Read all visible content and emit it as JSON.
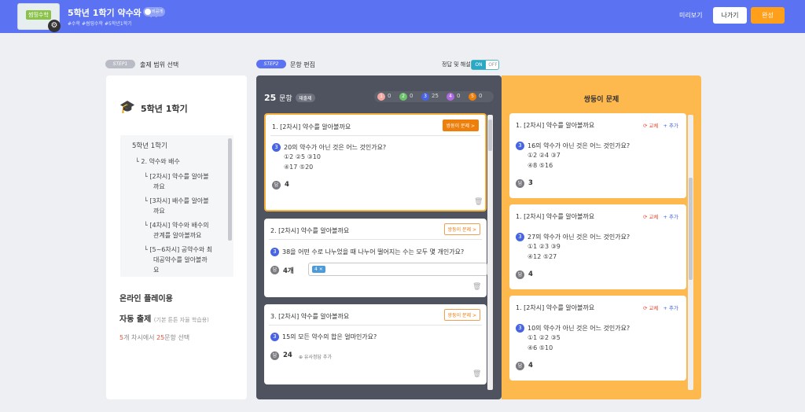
{
  "header": {
    "thumb_label": "썸띵수학",
    "title": "5학년 1학기 약수와 배수",
    "toggle_label": "비공개",
    "subtitle": "#수학 #썸띵수학 #5학년1학기",
    "preview": "미리보기",
    "exit": "나가기",
    "done": "완성"
  },
  "step1": {
    "badge": "STEP1",
    "label": "출제 범위 선택"
  },
  "step2": {
    "badge": "STEP2",
    "label": "문항 편집"
  },
  "answer_toggle": {
    "label": "정답 및 해설",
    "on": "ON",
    "off": "OFF"
  },
  "left": {
    "title": "5학년 1학기",
    "tree": [
      "5학년 1학기",
      "└ 2. 약수와 배수",
      "└ [2차시] 약수를 알아볼",
      "까요",
      "└ [3차시] 배수를 알아볼",
      "까요",
      "└ [4차시] 약수와 배수의",
      "관계를 알아볼까요",
      "└ [5~6차시] 공약수와 최",
      "대공약수를 알아볼까",
      "요"
    ],
    "online": "온라인 플레이용",
    "auto": "자동 출제",
    "auto_sub": "(기본 튼튼 자율 학습용)",
    "count_a": "5",
    "count_b": "개 차시에서 ",
    "count_c": "25",
    "count_d": "문항 선택"
  },
  "mid": {
    "count": "25",
    "count_unit": "문항",
    "reset": "재출제",
    "difficulty": [
      {
        "level": "1",
        "count": "0",
        "color": "#f2a7a2"
      },
      {
        "level": "2",
        "count": "0",
        "color": "#6cc26a"
      },
      {
        "level": "3",
        "count": "25",
        "color": "#4664e4"
      },
      {
        "level": "4",
        "count": "0",
        "color": "#b06ae0"
      },
      {
        "level": "5",
        "count": "0",
        "color": "#ef7f0b"
      }
    ],
    "twin_btn": "쌍둥이 문제 >",
    "q1": {
      "title": "1. [2차시] 약수를 알아볼까요",
      "level": "3",
      "text": "20의 약수가 아닌 것은 어느 것인가요?",
      "c1": "①2   ②5   ③10",
      "c2": "④17   ⑤20",
      "ans": "4"
    },
    "q2": {
      "title": "2. [2차시] 약수를 알아볼까요",
      "level": "3",
      "text": "38을 어떤 수로 나누었을 때 나누어 떨어지는 수는 모두 몇 개인가요?",
      "ans": "4개",
      "tag": "4 ×"
    },
    "q3": {
      "title": "3. [2차시] 약수를 알아볼까요",
      "level": "3",
      "text": "15의 모든 약수의 합은 얼마인가요?",
      "ans": "24",
      "similar": "⊕ 유사정답 추가"
    }
  },
  "right": {
    "title": "쌍둥이 문제",
    "replace": "교체",
    "add": "+ 추가",
    "q1": {
      "title": "1. [2차시] 약수를 알아볼까요",
      "level": "3",
      "text": "16의 약수가 아닌 것은 어느 것인가요?",
      "c1": "①2   ②4   ③7",
      "c2": "④8   ⑤16",
      "ans": "3"
    },
    "q2": {
      "title": "1. [2차시] 약수를 알아볼까요",
      "level": "3",
      "text": "27의 약수가 아닌 것은 어느 것인가요?",
      "c1": "①1   ②3   ③9",
      "c2": "④12   ⑤27",
      "ans": "4"
    },
    "q3": {
      "title": "1. [2차시] 약수를 알아볼까요",
      "level": "3",
      "text": "10의 약수가 아닌 것은 어느 것인가요?",
      "c1": "①1   ②2   ③5",
      "c2": "④6   ⑤10",
      "ans": "4"
    }
  }
}
